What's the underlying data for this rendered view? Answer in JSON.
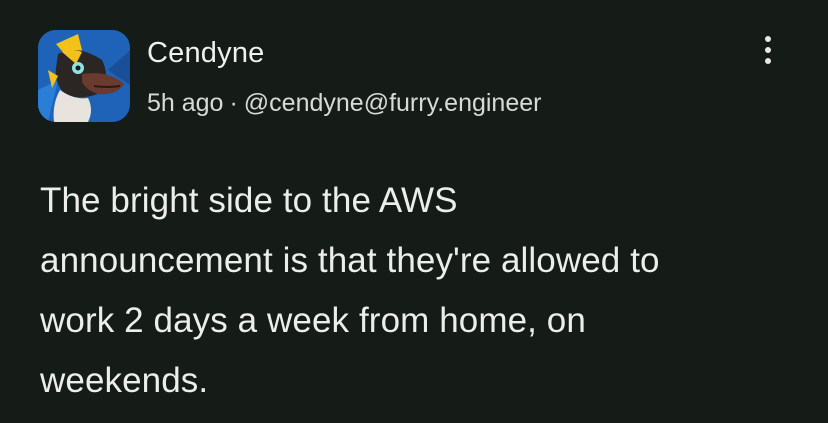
{
  "post": {
    "author": {
      "display_name": "Cendyne",
      "avatar_icon": "dragon-avatar-icon"
    },
    "meta": {
      "time": "5h ago",
      "separator": "·",
      "handle": "@cendyne@furry.engineer"
    },
    "more_icon": "vertical-ellipsis-icon",
    "body_lines": [
      "The bright side to the AWS",
      "announcement is that they're allowed to",
      "work 2 days a week from home, on",
      "weekends."
    ]
  },
  "colors": {
    "background": "#151b17",
    "text": "#eceeec",
    "avatar_bg": "#1e63b8",
    "avatar_accent": "#f2c21b"
  }
}
